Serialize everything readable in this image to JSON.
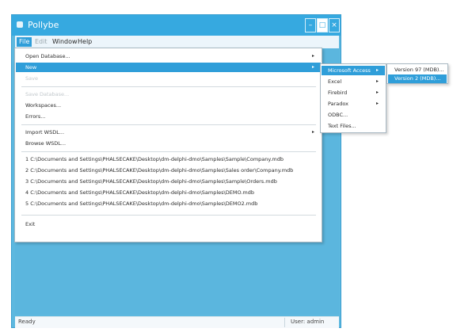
{
  "window": {
    "title": "Pollybe",
    "min_glyph": "–",
    "max_glyph": "□",
    "close_glyph": "×"
  },
  "menubar": {
    "items": [
      "File",
      "Edit",
      "Window",
      "Help"
    ]
  },
  "file_menu": {
    "items": [
      {
        "label": "Open Database..."
      },
      {
        "label": "New"
      },
      {
        "label": "Save"
      },
      {
        "label": "Save Database..."
      },
      {
        "label": "Workspaces..."
      },
      {
        "label": "Errors..."
      },
      {
        "label": "Import WSDL..."
      },
      {
        "label": "Browse WSDL..."
      },
      {
        "label": "1 C:\\Documents and Settings\\PHALSECAKE\\Desktop\\dm-delphi-dmo\\Samples\\Sample\\Company.mdb"
      },
      {
        "label": "2 C:\\Documents and Settings\\PHALSECAKE\\Desktop\\dm-delphi-dmo\\Samples\\Sales order\\Company.mdb"
      },
      {
        "label": "3 C:\\Documents and Settings\\PHALSECAKE\\Desktop\\dm-delphi-dmo\\Samples\\Sample\\Orders.mdb"
      },
      {
        "label": "4 C:\\Documents and Settings\\PHALSECAKE\\Desktop\\dm-delphi-dmo\\Samples\\DEMO.mdb"
      },
      {
        "label": "5 C:\\Documents and Settings\\PHALSECAKE\\Desktop\\dm-delphi-dmo\\Samples\\DEMO2.mdb"
      },
      {
        "label": "Exit"
      }
    ]
  },
  "submenu_new": {
    "items": [
      "Microsoft Access",
      "Excel",
      "Firebird",
      "Paradox",
      "ODBC...",
      "Text Files..."
    ]
  },
  "submenu_access": {
    "items": [
      "Version 97 (MDB)...",
      "Version 2 (MDB)..."
    ]
  },
  "status": {
    "left": "Ready",
    "right": "User: admin"
  },
  "colors": {
    "accent": "#2f9ed9",
    "titlebar": "#36a9e0",
    "client": "#5bb6de"
  }
}
